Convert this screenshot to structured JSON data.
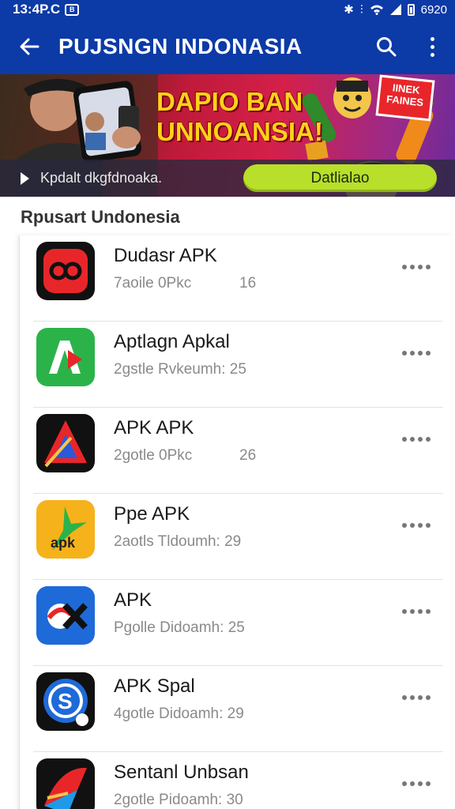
{
  "status_bar": {
    "time": "13:4P.C",
    "badge": "B",
    "battery_text": "6920",
    "icons": [
      "bluetooth-icon",
      "signal-icon",
      "wifi-icon",
      "cellular-icon",
      "battery-icon"
    ]
  },
  "app_bar": {
    "title": "PUJSNGN INDONASIA",
    "icons": [
      "back-arrow-icon",
      "search-icon",
      "more-vertical-icon"
    ],
    "color": "#0c3aa6"
  },
  "banner": {
    "headline_line1": "DAPIO BAN",
    "headline_line2": "UNNOANSIA!",
    "badge_line1": "IINEK",
    "badge_line2": "FAINES",
    "strip_text": "Kpdalt dkgfdnoaka.",
    "button_label": "Datlialao",
    "button_color": "#b8df2a"
  },
  "section": {
    "title": "Rpusart Undonesia"
  },
  "apps": [
    {
      "name": "Dudasr APK",
      "meta": "7aoile 0Pkc",
      "count": "16",
      "icon": "red-eye-logo-icon"
    },
    {
      "name": "Aptlagn Apkal",
      "meta": "2gstle Rvkeumh: 25",
      "count": "",
      "icon": "green-letter-a-icon"
    },
    {
      "name": "APK APK",
      "meta": "2gotle 0Pkc",
      "count": "26",
      "icon": "red-triangle-logo-icon"
    },
    {
      "name": "Ppe APK",
      "meta": "2aotls Tldoumh: 29",
      "count": "",
      "icon": "yellow-apk-icon"
    },
    {
      "name": "APK",
      "meta": "Pgolle Didoamh: 25",
      "count": "",
      "icon": "blue-x-logo-icon"
    },
    {
      "name": "APK Spal",
      "meta": "4gotle Didoamh: 29",
      "count": "",
      "icon": "blue-circle-s-icon"
    },
    {
      "name": "Sentanl Unbsan",
      "meta": "2gotle Pidoamh: 30",
      "count": "",
      "icon": "colorful-swoosh-icon"
    }
  ]
}
